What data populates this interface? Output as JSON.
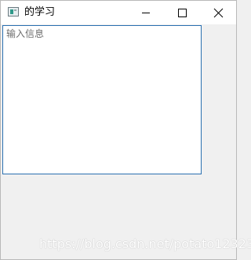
{
  "window": {
    "title": "的学习"
  },
  "text_input": {
    "placeholder": "输入信息"
  },
  "watermark": {
    "text": "https://blog.csdn.net/potato123232"
  },
  "icons": {
    "app": "app-window-icon",
    "minimize": "minimize-icon",
    "maximize": "maximize-icon",
    "close": "close-icon"
  },
  "colors": {
    "titlebar_bg": "#ffffff",
    "window_bg": "#f0f0f0",
    "input_border": "#2a6fb0",
    "placeholder": "#6d6d6d"
  }
}
